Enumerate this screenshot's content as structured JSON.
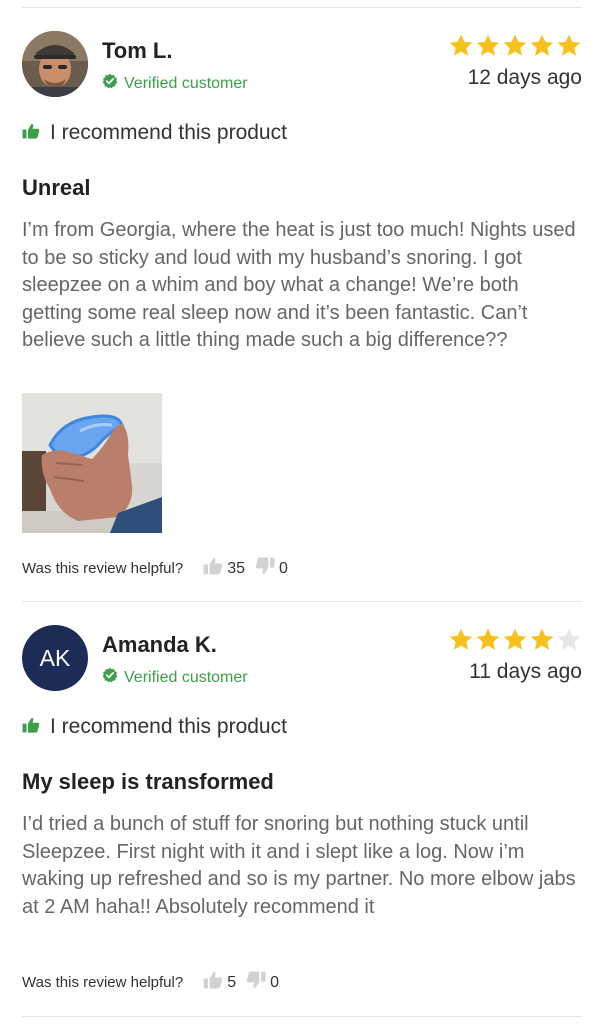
{
  "reviews": [
    {
      "name": "Tom L.",
      "avatar_type": "photo",
      "verified_label": "Verified customer",
      "rating": 5,
      "date": "12 days ago",
      "recommend_label": "I recommend this product",
      "title": "Unreal",
      "body": "I’m from Georgia, where the heat is just too much! Nights used to be so sticky and loud with my husband’s snoring. I got sleepzee on a whim and boy what a change! We’re both getting some real sleep now and it’s been fantastic. Can’t believe such a little thing made such a big difference??",
      "has_photo": true,
      "helpful_label": "Was this review helpful?",
      "helpful_yes": "35",
      "helpful_no": "0"
    },
    {
      "name": "Amanda K.",
      "avatar_initials": "AK",
      "verified_label": "Verified customer",
      "rating": 4,
      "date": "11 days ago",
      "recommend_label": "I recommend this product",
      "title": "My sleep is transformed",
      "body": "I’d tried a bunch of stuff for snoring but nothing stuck until Sleepzee. First night with it and i slept like a log. Now i’m waking up refreshed and so is my partner. No more elbow jabs at 2 AM haha!! Absolutely recommend it",
      "has_photo": false,
      "helpful_label": "Was this review helpful?",
      "helpful_yes": "5",
      "helpful_no": "0"
    }
  ],
  "colors": {
    "star_filled": "#f6c11d",
    "star_empty": "#e6e6e6",
    "verified_green": "#3c9f4a",
    "recommend_green": "#3c9f4a",
    "avatar_navy": "#1d2b57"
  }
}
